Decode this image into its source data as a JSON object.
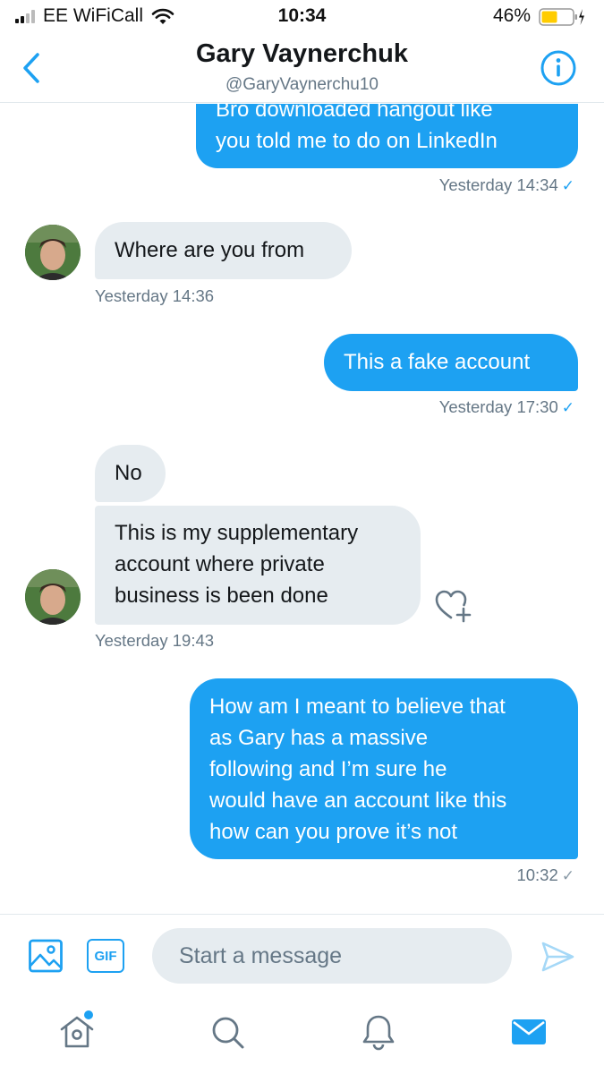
{
  "status_bar": {
    "carrier": "EE WiFiCall",
    "time": "10:34",
    "battery": "46%"
  },
  "header": {
    "title": "Gary Vaynerchuk",
    "handle": "@GaryVaynerchu10",
    "back_icon": "chevron-left-icon",
    "info_icon": "info-icon"
  },
  "messages": [
    {
      "side": "sent",
      "lines": [
        "Bro downloaded hangout like",
        "you told me to do on LinkedIn"
      ],
      "meta": "Yesterday 14:34",
      "read": true
    },
    {
      "side": "received",
      "lines": [
        "Where are you from"
      ],
      "meta": "Yesterday 14:36"
    },
    {
      "side": "sent",
      "lines": [
        "This a fake account"
      ],
      "meta": "Yesterday 17:30",
      "read": true
    },
    {
      "side": "received",
      "lines": [
        "No"
      ]
    },
    {
      "side": "received",
      "lines": [
        "This is my supplementary",
        "account where private",
        "business is been done"
      ],
      "meta": "Yesterday 19:43"
    },
    {
      "side": "sent",
      "lines": [
        "How am I meant to believe that",
        "as Gary has a massive",
        "following and I’m sure he",
        "would have an account like this",
        "how can you prove it’s not"
      ],
      "meta": "10:32",
      "read": false
    }
  ],
  "composer": {
    "placeholder": "Start a message",
    "gif_label": "GIF"
  },
  "tabs": [
    "home-icon",
    "search-icon",
    "notifications-icon",
    "messages-icon"
  ],
  "colors": {
    "accent": "#1da1f2",
    "received_bubble": "#e6ecf0",
    "meta_text": "#657786"
  }
}
